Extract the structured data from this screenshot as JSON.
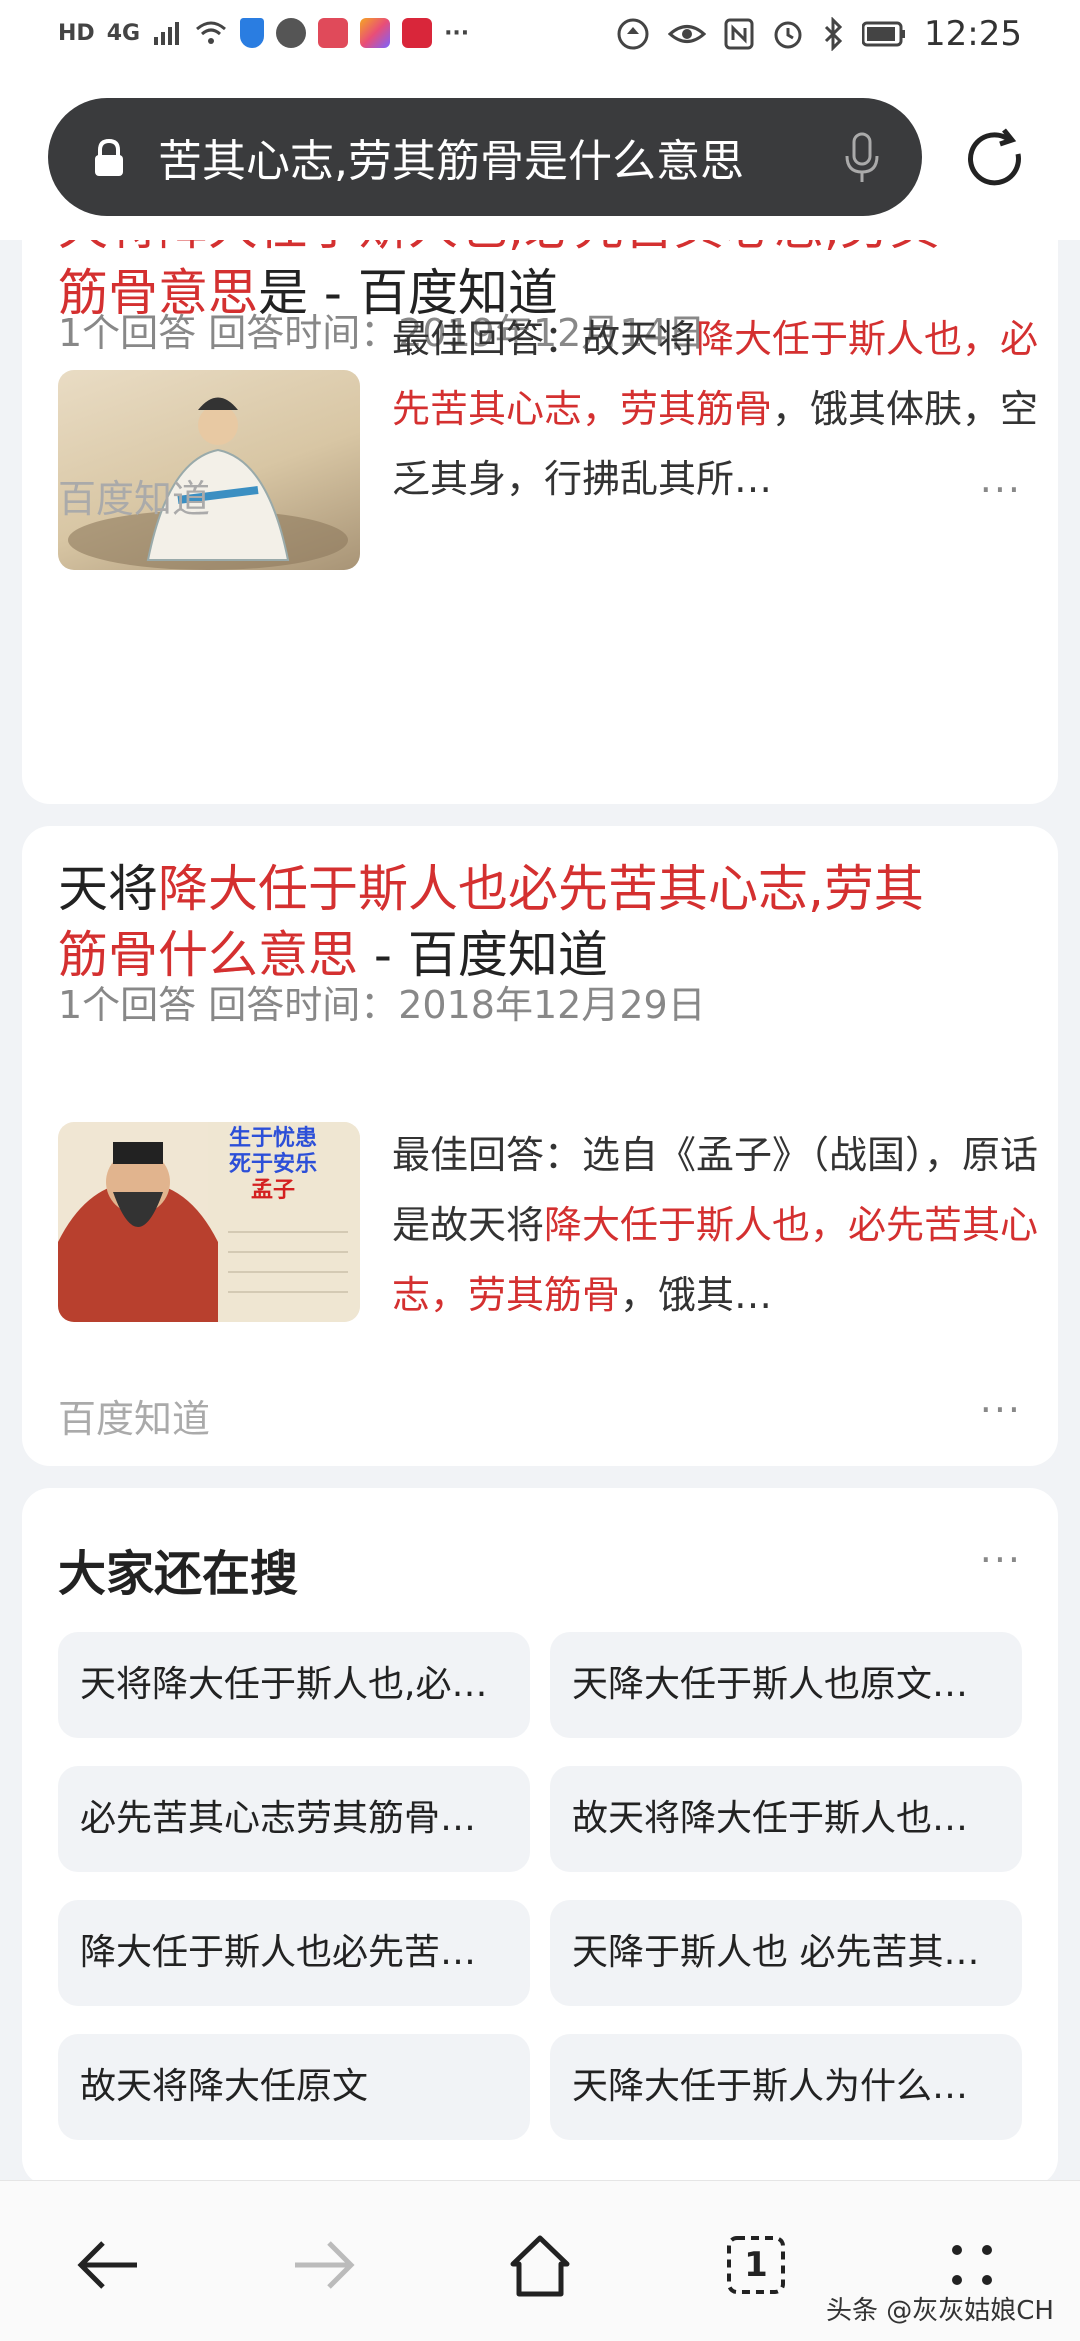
{
  "status_bar": {
    "left_badges": [
      "HD",
      "4G"
    ],
    "time": "12:25"
  },
  "search": {
    "query": "苦其心志,劳其筋骨是什么意思"
  },
  "results": [
    {
      "title_red": "降大任于斯人也,必先苦其心志,劳其筋骨意思",
      "title_red_line1": "天将降大任于斯人也,必先苦其心志,劳其",
      "title_line2_red": "筋骨意思",
      "title_line2_black": "是 - 百度知道",
      "meta": "1个回答   回答时间：2019年12月14日",
      "snippet_prefix": "最佳回答：故天将",
      "snippet_red": "降大任于斯人也，必先苦其心志，劳其筋骨",
      "snippet_suffix": "，饿其体肤，空乏其身，行拂乱其所…",
      "source": "百度知道",
      "more": "···"
    },
    {
      "title_black_start": "天将",
      "title_red_line1": "降大任于斯人也必先苦其心志,劳其",
      "title_line2_red": "筋骨什么意思",
      "title_line2_black": " - 百度知道",
      "meta": "1个回答   回答时间：2018年12月29日",
      "snippet_prefix": "最佳回答：选自《孟子》（战国）",
      "snippet_mid": "，原话是故天将",
      "snippet_red": "降大任于斯人也，必先苦其心志，劳其筋骨",
      "snippet_suffix": "，饿其…",
      "thumb_caption": [
        "生于忧患",
        "死于安乐",
        "孟子"
      ],
      "source": "百度知道",
      "more": "···"
    }
  ],
  "related": {
    "title": "大家还在搜",
    "more": "···",
    "items": [
      "天将降大任于斯人也,必…",
      "天降大任于斯人也原文…",
      "必先苦其心志劳其筋骨…",
      "故天将降大任于斯人也…",
      "降大任于斯人也必先苦…",
      "天降于斯人也 必先苦其…",
      "故天将降大任原文",
      "天降大任于斯人为什么…"
    ]
  },
  "nav": {
    "tab_count": "1"
  },
  "watermark": "头条 @灰灰姑娘CH"
}
